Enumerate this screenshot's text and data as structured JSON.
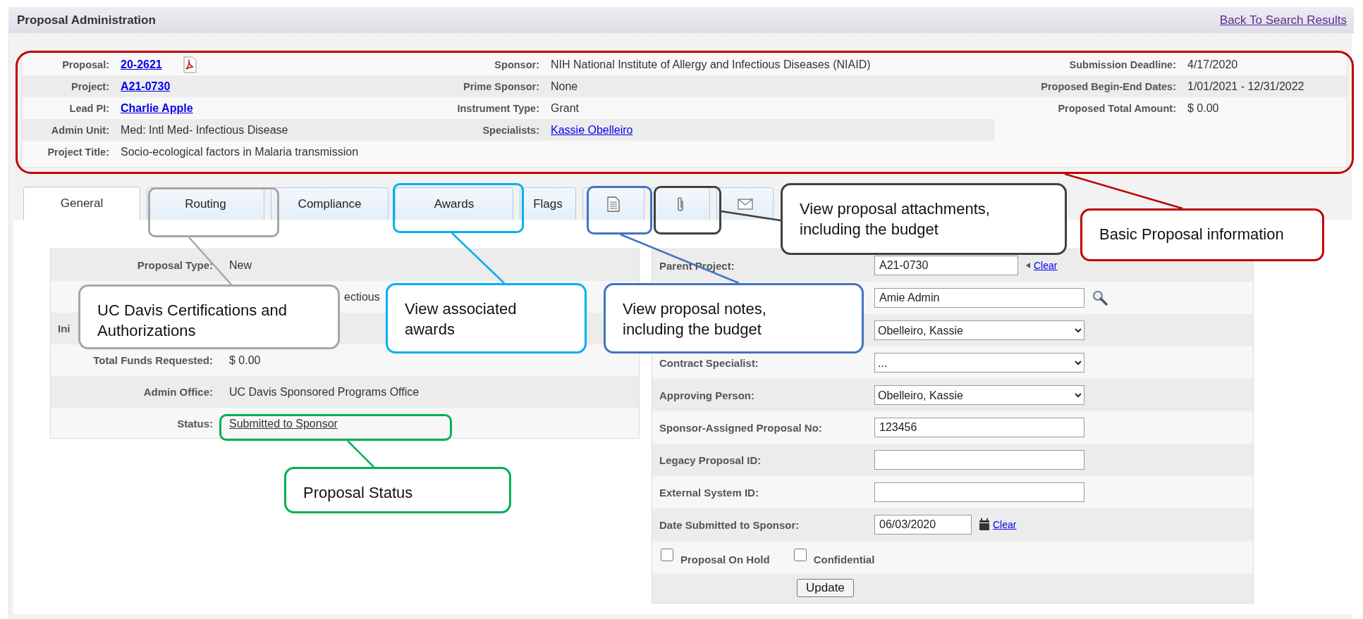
{
  "header": {
    "title": "Proposal Administration",
    "back_link": "Back To Search Results"
  },
  "summary": {
    "columns": [
      {
        "fields": [
          {
            "label": "Proposal:",
            "value": "20-2621",
            "kind": "strong_link"
          },
          {
            "label": "Project:",
            "value": "A21-0730",
            "kind": "strong_link"
          },
          {
            "label": "Lead PI:",
            "value": "Charlie Apple",
            "kind": "strong_link"
          },
          {
            "label": "Admin Unit:",
            "value": "Med: Intl Med- Infectious Disease",
            "kind": "text"
          },
          {
            "label": "Project Title:",
            "value": "Socio-ecological factors in Malaria transmission",
            "kind": "text"
          }
        ]
      },
      {
        "fields": [
          {
            "label": "Sponsor:",
            "value": "NIH National Institute of Allergy and Infectious Diseases (NIAID)",
            "kind": "text"
          },
          {
            "label": "Prime Sponsor:",
            "value": "None",
            "kind": "text"
          },
          {
            "label": "Instrument Type:",
            "value": "Grant",
            "kind": "text"
          },
          {
            "label": "Specialists:",
            "value": "Kassie Obelleiro ",
            "kind": "link"
          }
        ]
      },
      {
        "fields": [
          {
            "label": "Submission Deadline:",
            "value": "4/17/2020",
            "kind": "text"
          },
          {
            "label": "Proposed Begin-End Dates:",
            "value": "1/01/2021 - 12/31/2022",
            "kind": "text"
          },
          {
            "label": "Proposed Total Amount:",
            "value": "$ 0.00",
            "kind": "text"
          }
        ]
      }
    ]
  },
  "tabs": [
    {
      "kind": "text",
      "label": "General",
      "selected": true
    },
    {
      "kind": "text",
      "label": "Routing",
      "selected": false
    },
    {
      "kind": "text",
      "label": "Compliance",
      "selected": false
    },
    {
      "kind": "text",
      "label": "Awards",
      "selected": false
    },
    {
      "kind": "text",
      "label": "Flags",
      "selected": false
    },
    {
      "kind": "notes",
      "selected": false
    },
    {
      "kind": "attachments",
      "selected": false
    },
    {
      "kind": "mail",
      "selected": false
    }
  ],
  "general": {
    "fields": [
      {
        "label": "Proposal Type:",
        "value": "New",
        "kind": "text"
      },
      {
        "value": "ectious",
        "kind": "partial"
      },
      {
        "label": "Ini",
        "kind": "partial"
      },
      {
        "label": "Total Funds Requested:",
        "value": "$ 0.00",
        "kind": "text"
      },
      {
        "label": "Admin Office:",
        "value": "UC Davis Sponsored Programs Office",
        "kind": "text"
      },
      {
        "label": "Status:",
        "value": "Submitted to Sponsor",
        "kind": "link"
      }
    ]
  },
  "details": {
    "fields": [
      {
        "label": "Parent Project:",
        "value": "A21-0730",
        "kind": "input",
        "link": "Clear"
      },
      {
        "value": "Amie Admin",
        "kind": "lookup"
      },
      {
        "value": "Obelleiro, Kassie",
        "kind": "select"
      },
      {
        "label": "Contract Specialist:",
        "value": "...",
        "kind": "select"
      },
      {
        "label": "Approving Person:",
        "value": "Obelleiro, Kassie",
        "kind": "select"
      },
      {
        "label": "Sponsor-Assigned Proposal No:",
        "value": "123456",
        "kind": "input"
      },
      {
        "label": "Legacy Proposal ID:",
        "kind": "input"
      },
      {
        "label": "External System ID:",
        "kind": "input"
      },
      {
        "label": "Date Submitted to Sponsor:",
        "value": "06/03/2020",
        "kind": "date",
        "link": "Clear"
      }
    ],
    "checkboxes": [
      {
        "label": "Proposal On Hold",
        "checked": false
      },
      {
        "label": "Confidential",
        "checked": false
      }
    ],
    "button": "Update"
  },
  "annotations": [
    {
      "text": "Basic Proposal information",
      "color": "#c00000"
    },
    {
      "text": "UC Davis Certifications and Authorizations",
      "color": "#a6a6a6"
    },
    {
      "text": "View associated awards",
      "color": "#00b0f0"
    },
    {
      "text": "View proposal notes, including the budget",
      "color": "#4472c4"
    },
    {
      "text": "View proposal attachments, including the budget",
      "color": "#404040"
    },
    {
      "text": "Proposal Status",
      "color": "#00b050"
    }
  ]
}
